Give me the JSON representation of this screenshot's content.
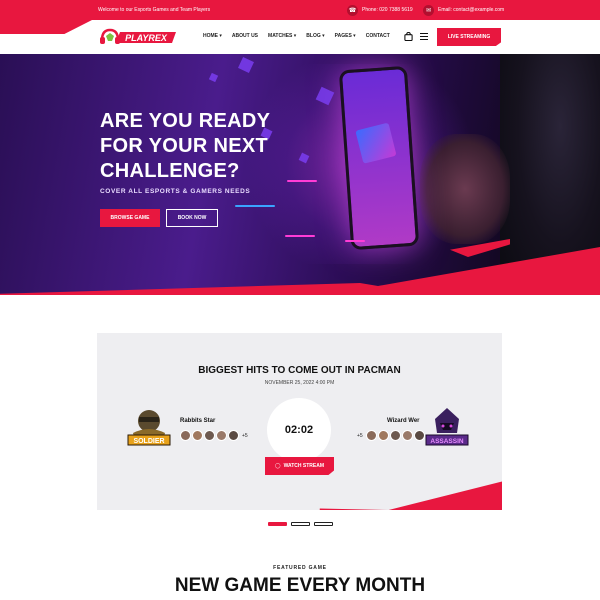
{
  "topbar": {
    "welcome": "Welcome to our Esports Games and Team Players",
    "phone": "Phone: 020 7388 5619",
    "email": "Email: contact@example.com"
  },
  "nav": {
    "logo_text": "PLAYREX",
    "items": [
      "HOME",
      "ABOUT US",
      "MATCHES",
      "BLOG",
      "PAGES",
      "CONTACT"
    ],
    "live_button": "LIVE STREAMING"
  },
  "hero": {
    "title": "ARE YOU READY FOR YOUR NEXT CHALLENGE?",
    "subtitle": "COVER ALL ESPORTS & GAMERS NEEDS",
    "browse_button": "BROWSE GAME",
    "book_button": "BOOK NOW"
  },
  "match": {
    "title": "BIGGEST HITS TO COME OUT IN PACMAN",
    "date": "NOVEMBER 25, 2022 4:00 PM",
    "team_left": {
      "name": "Rabbits Star",
      "logo_text": "SOLDIER",
      "extra": "+5"
    },
    "team_right": {
      "name": "Wizard Wer",
      "logo_text": "ASSASSIN",
      "extra": "+5"
    },
    "timer": "02:02",
    "watch_button": "WATCH STREAM"
  },
  "featured": {
    "label": "FEATURED GAME",
    "title": "NEW GAME EVERY MONTH"
  },
  "colors": {
    "accent": "#e8173f",
    "hero_purple": "#4a1c8c"
  }
}
